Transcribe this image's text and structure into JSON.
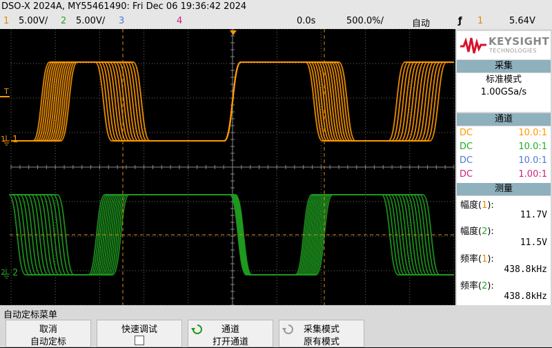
{
  "header": {
    "title": "DSO-X 2024A, MY55461490: Fri Dec 06 19:36:42 2024",
    "ch1_num": "1",
    "ch1_scale": "5.00V/",
    "ch2_num": "2",
    "ch2_scale": "5.00V/",
    "ch3_num": "3",
    "ch4_num": "4",
    "delay": "0.0s",
    "timebase": "500.0%/",
    "trigger_mode": "自动",
    "trigger_slope": "ƒ",
    "trigger_source": "1",
    "trigger_level": "5.64V"
  },
  "waveform": {
    "trigger_marker": "T",
    "ch1_marker": "1",
    "ch2_marker": "2",
    "ch1_color": "#ff9900",
    "ch2_color": "#1a9c1a"
  },
  "panel": {
    "logo_brand": "KEYSIGHT",
    "logo_sub": "TECHNOLOGIES",
    "acquire_header": "采集",
    "acquire_mode": "标准模式",
    "sample_rate": "1.00GSa/s",
    "channels_header": "通道",
    "channels": [
      {
        "coupling": "DC",
        "probe": "10.0:1",
        "color": "#ff9900"
      },
      {
        "coupling": "DC",
        "probe": "10.0:1",
        "color": "#22aa22"
      },
      {
        "coupling": "DC",
        "probe": "10.0:1",
        "color": "#4a7bd0"
      },
      {
        "coupling": "DC",
        "probe": "1.00:1",
        "color": "#cc2277"
      }
    ],
    "measure_header": "测量",
    "measurements": [
      {
        "pre": "幅度(",
        "ch": "1",
        "post": "):",
        "value": "11.7V",
        "ch_color": "#e08a00"
      },
      {
        "pre": "幅度(",
        "ch": "2",
        "post": "):",
        "value": "11.5V",
        "ch_color": "#22aa22"
      },
      {
        "pre": "频率(",
        "ch": "1",
        "post": "):",
        "value": "438.8kHz",
        "ch_color": "#e08a00"
      },
      {
        "pre": "频率(",
        "ch": "2",
        "post": "):",
        "value": "438.8kHz",
        "ch_color": "#22aa22"
      }
    ]
  },
  "menu": {
    "title": "自动定标菜单",
    "softkeys": [
      {
        "line1": "取消",
        "line2": "自动定标"
      },
      {
        "line1": "快速调试",
        "line2": ""
      },
      {
        "line1": "通道",
        "line2": "打开通道"
      },
      {
        "line1": "采集模式",
        "line2": "原有模式"
      }
    ]
  }
}
